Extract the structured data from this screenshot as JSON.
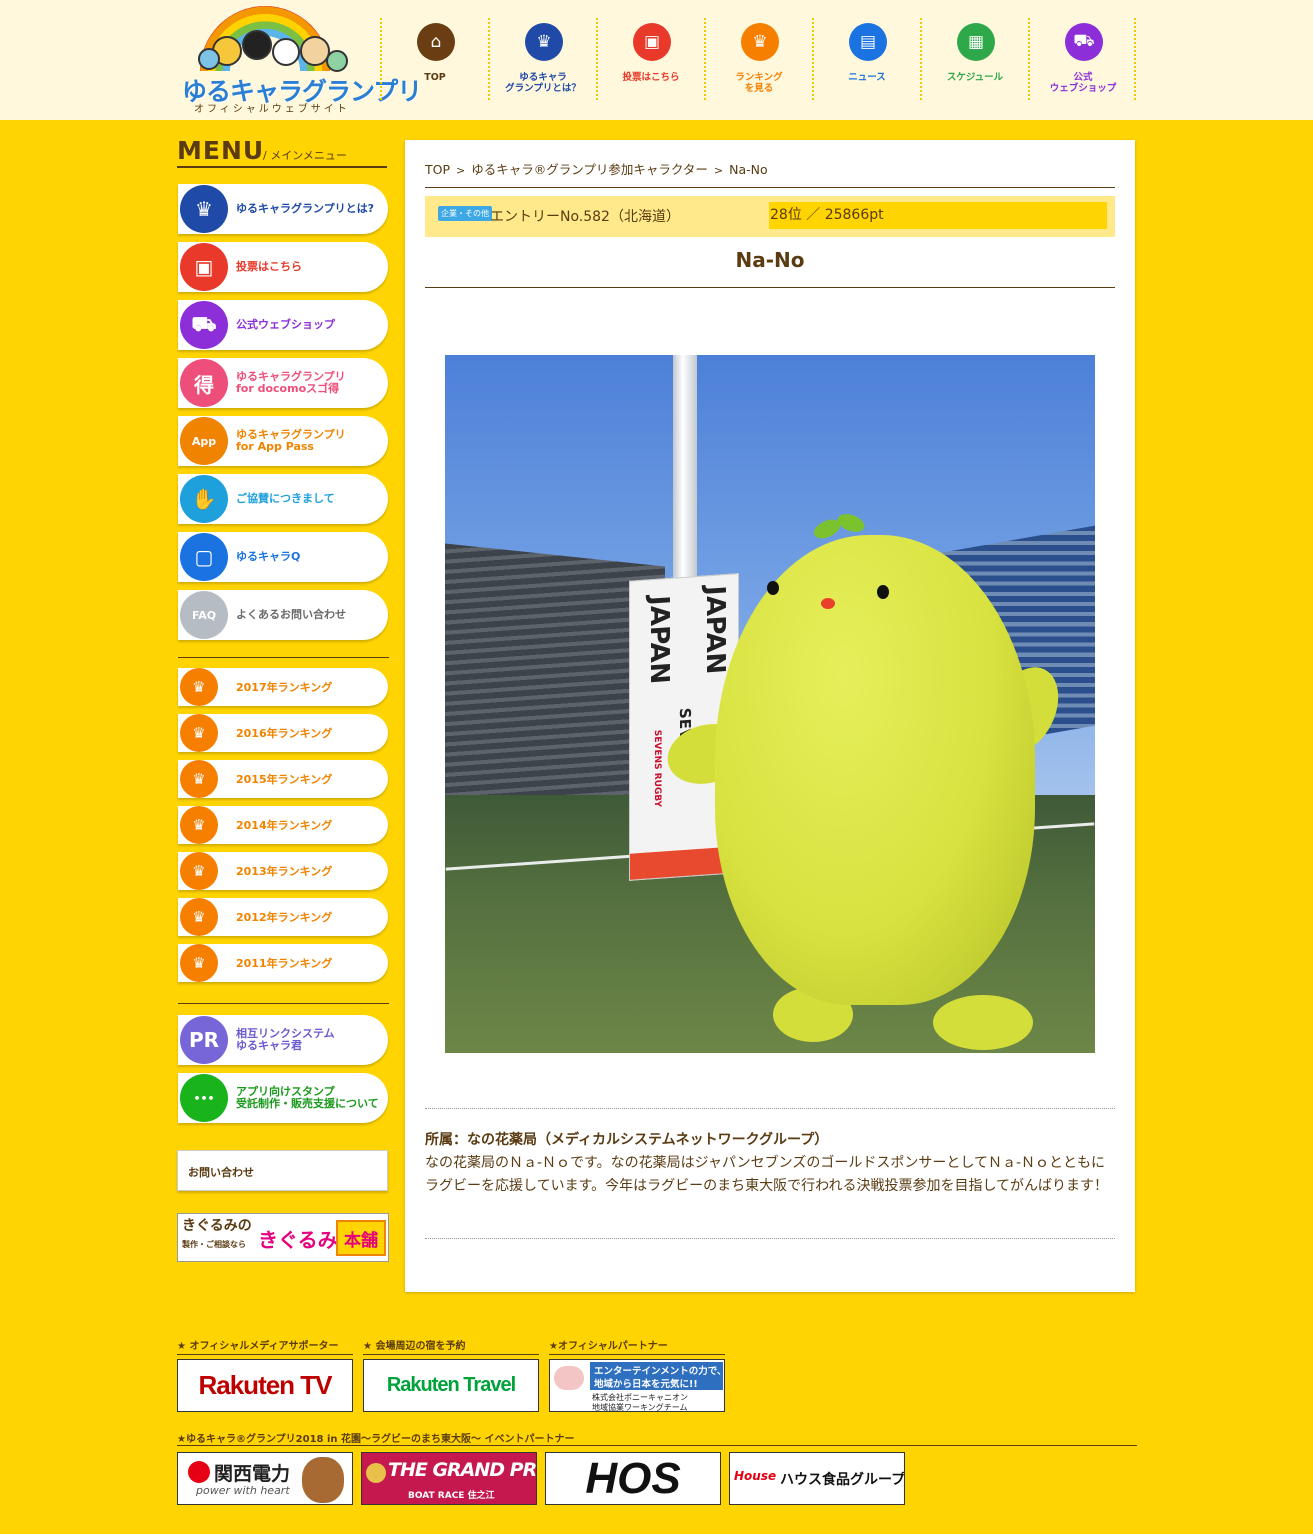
{
  "header": {
    "logo_title": "ゆるキャラグランプリ",
    "logo_sub": "オフィシャルウェブサイト",
    "nav": [
      {
        "label": "TOP",
        "color": "#6b3d12",
        "icon": "home-icon",
        "text_color": "#5a3b12"
      },
      {
        "label": "ゆるキャラ\nグランプリとは？",
        "color": "#1f4aa8",
        "icon": "trophy-icon",
        "text_color": "#1f4aa8"
      },
      {
        "label": "投票はこちら",
        "color": "#e8392a",
        "icon": "vote-icon",
        "text_color": "#e8392a"
      },
      {
        "label": "ランキング\nを見る",
        "color": "#f77f00",
        "icon": "crown-icon",
        "text_color": "#f77f00"
      },
      {
        "label": "ニュース",
        "color": "#1a73e0",
        "icon": "news-icon",
        "text_color": "#1a73e0"
      },
      {
        "label": "スケジュール",
        "color": "#2fa84a",
        "icon": "calendar-icon",
        "text_color": "#2fa84a"
      },
      {
        "label": "公式\nウェブショップ",
        "color": "#8c2fd8",
        "icon": "cart-icon",
        "text_color": "#8c2fd8"
      }
    ]
  },
  "sidebar": {
    "menu_big": "MENU",
    "menu_small": "/ メインメニュー",
    "items": [
      {
        "label": "ゆるキャラグランプリとは?",
        "color": "#1f4aa8",
        "icon": "trophy-icon",
        "glyph": "♛",
        "text_color": "#1f4aa8"
      },
      {
        "label": "投票はこちら",
        "color": "#e8392a",
        "icon": "vote-icon",
        "glyph": "▣",
        "text_color": "#e8392a"
      },
      {
        "label": "公式ウェブショップ",
        "color": "#8c2fd8",
        "icon": "cart-icon",
        "glyph": "⛟",
        "text_color": "#8c2fd8"
      },
      {
        "label": "ゆるキャラグランプリ\nfor docomoスゴ得",
        "color": "#ee4f7a",
        "icon": "toku-icon",
        "glyph": "得",
        "text_color": "#ee4f7a"
      },
      {
        "label": "ゆるキャラグランプリ\nfor App Pass",
        "color": "#f08300",
        "icon": "app-icon",
        "glyph": "App",
        "text_color": "#f08300"
      },
      {
        "label": "ご協賛につきまして",
        "color": "#1ea0dc",
        "icon": "handshake-icon",
        "glyph": "✋",
        "text_color": "#1ea0dc"
      },
      {
        "label": "ゆるキャラQ",
        "color": "#1a73e0",
        "icon": "tv-icon",
        "glyph": "▢",
        "text_color": "#1a73e0"
      },
      {
        "label": "よくあるお問い合わせ",
        "color": "#b5bcc4",
        "icon": "faq-icon",
        "glyph": "FAQ",
        "text_color": "#6b6b6b"
      }
    ],
    "rankings": [
      "2017年ランキング",
      "2016年ランキング",
      "2015年ランキング",
      "2014年ランキング",
      "2013年ランキング",
      "2012年ランキング",
      "2011年ランキング"
    ],
    "extras": [
      {
        "label": "相互リンクシステム\nゆるキャラ君",
        "color": "#7766d8",
        "icon": "pr-icon",
        "glyph": "PR",
        "text_color": "#6a5ad0"
      },
      {
        "label": "アプリ向けスタンプ\n受託制作・販売支援について",
        "color": "#19b31c",
        "icon": "chat-icon",
        "glyph": "•••",
        "text_color": "#1a9a1c"
      }
    ],
    "contact": "お問い合わせ",
    "banner_a": "きぐるみの",
    "banner_a2": "製作・ご相談なら",
    "banner_b": "きぐるみ",
    "banner_c": "本舗"
  },
  "main": {
    "breadcrumb": [
      "TOP",
      "ゆるキャラ®グランプリ参加キャラクター",
      "Na-No"
    ],
    "tag": "企業・その他",
    "entry": "エントリーNo.582（北海道）",
    "rank": "28位 ／ 25866pt",
    "name": "Na-No",
    "photo_texts": [
      "JAPAN",
      "SEVENS",
      "JAPAN",
      "SEVENS RUGBY"
    ],
    "affiliation": "所属：なの花薬局（メディカルシステムネットワークグループ）",
    "description": "なの花薬局のＮａ-Ｎｏです。なの花薬局はジャパンセブンズのゴールドスポンサーとしてＮａ-Ｎｏとともにラグビーを応援しています。今年はラグビーのまち東大阪で行われる決戦投票参加を目指してがんばります！"
  },
  "footer": {
    "heads": [
      "★ オフィシャルメディアサポーター",
      "★ 会場周辺の宿を予約",
      "★オフィシャルパートナー"
    ],
    "sponsor1": "Rakuten TV",
    "sponsor2": "Rakuten Travel",
    "sponsor3a": "エンターテインメントの力で、",
    "sponsor3b": "地域から日本を元気に!!",
    "sponsor3c": "株式会社ポニーキャニオン",
    "sponsor3d": "地域協業ワーキングチーム",
    "event_head": "★ゆるキャラ®グランプリ2018 in 花園～ラグビーのまち東大阪～ イベントパートナー",
    "ev1": "関西電力",
    "ev1b": "power with heart",
    "ev2": "THE GRAND PRIX",
    "ev2b": "BOAT RACE 住之江",
    "ev3": "HOS",
    "ev4": "ハウス食品グループ",
    "ev4b": "House"
  }
}
